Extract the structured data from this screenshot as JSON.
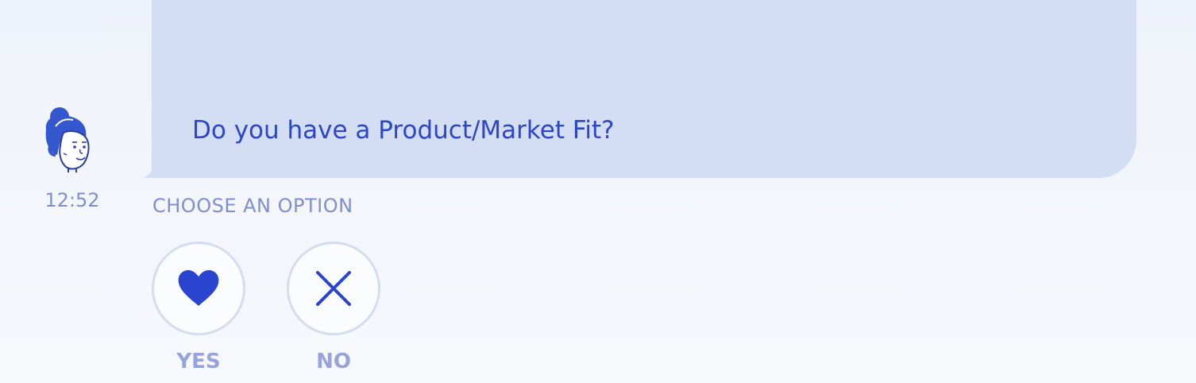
{
  "chat": {
    "message": "Do you have a Product/Market Fit?",
    "timestamp": "12:52",
    "avatar_icon": "woman-avatar-icon",
    "bubble_color": "#d3ddf4",
    "text_color": "#2b46c8"
  },
  "options": {
    "prompt": "CHOOSE AN OPTION",
    "yes": {
      "label": "YES",
      "icon": "heart-icon"
    },
    "no": {
      "label": "NO",
      "icon": "close-icon"
    }
  }
}
